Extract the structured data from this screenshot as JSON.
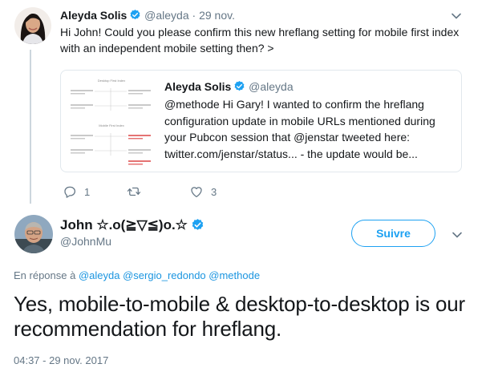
{
  "parent_tweet": {
    "name": "Aleyda Solis",
    "handle": "@aleyda",
    "separator": "·",
    "time": "29 nov.",
    "text": "Hi John! Could you please confirm this new hreflang setting for mobile first index with an independent mobile setting then? >",
    "quoted": {
      "name": "Aleyda Solis",
      "handle": "@aleyda",
      "text": "@methode Hi Gary! I wanted to confirm the hreflang configuration update in mobile URLs mentioned during your Pubcon session that @jenstar tweeted here: twitter.com/jenstar/status... - the update would be...",
      "media_titles": [
        "Desktop First Index",
        "Mobile First Index"
      ]
    },
    "actions": {
      "reply_count": "1",
      "retweet_count": "",
      "like_count": "3"
    }
  },
  "main_tweet": {
    "name": "John ☆.o(≧▽≦)o.☆",
    "handle": "@JohnMu",
    "follow_label": "Suivre",
    "reply_prefix": "En réponse à",
    "reply_mentions": [
      "@aleyda",
      "@sergio_redondo",
      "@methode"
    ],
    "text": "Yes, mobile-to-mobile & desktop-to-desktop is our recommendation for hreflang.",
    "timestamp": "04:37 - 29 nov. 2017"
  },
  "colors": {
    "accent": "#1da1f2",
    "link": "#1b95e0",
    "muted": "#657786",
    "text": "#14171a",
    "border": "#e1e8ed"
  },
  "icons": [
    "verified-badge-icon",
    "chevron-down-icon",
    "reply-icon",
    "retweet-icon",
    "like-icon"
  ]
}
